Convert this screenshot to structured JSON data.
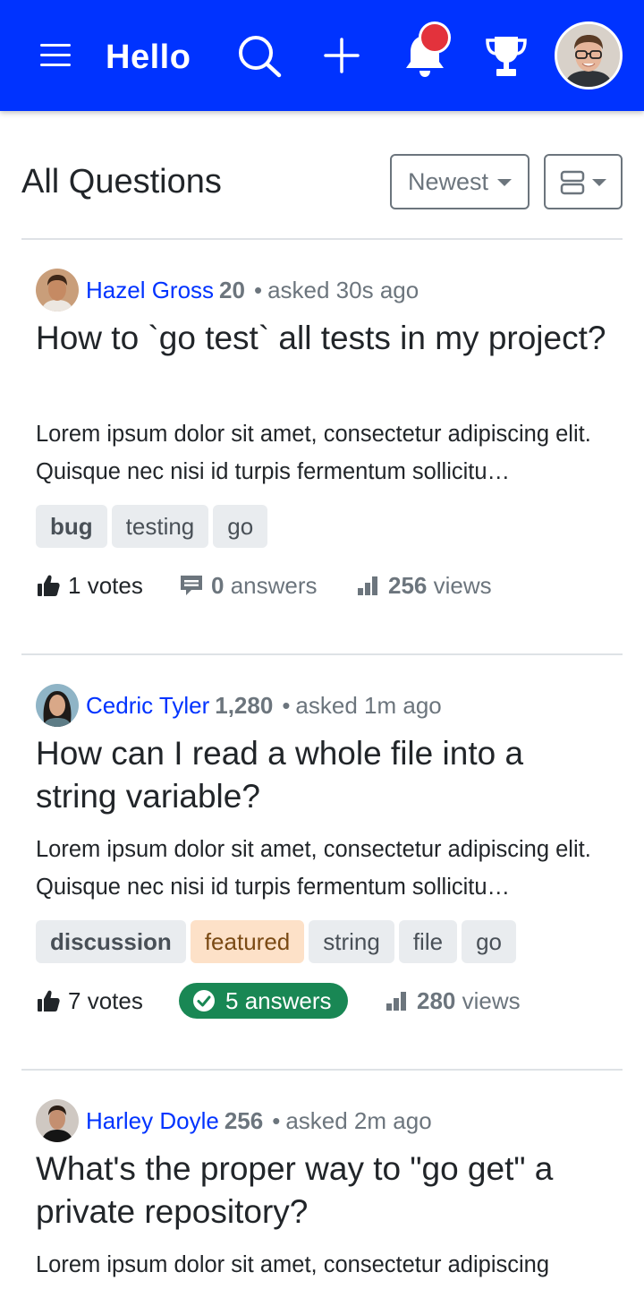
{
  "nav": {
    "brand": "Hello",
    "menu_icon": "hamburger-menu-icon",
    "search_icon": "search-icon",
    "add_icon": "plus-icon",
    "notification_icon": "bell-icon",
    "achievements_icon": "trophy-icon",
    "accent_color": "#0033ff",
    "notification_dot_color": "#e3323c"
  },
  "header": {
    "title": "All Questions",
    "sort_label": "Newest",
    "view_toggle_icon": "list-view-icon"
  },
  "questions": [
    {
      "user": "Hazel Gross",
      "reputation": "20",
      "asked": "asked 30s ago",
      "title": "How to `go test` all tests in my project?",
      "excerpt": "Lorem ipsum dolor sit amet, consectetur adipiscing elit. Quisque nec nisi id turpis fermentum sollicitu…",
      "tags": [
        "bug",
        "testing",
        "go"
      ],
      "votes": "1",
      "votes_label": "votes",
      "answers": "0",
      "answers_label": "answers",
      "views": "256",
      "views_label": "views"
    },
    {
      "user": "Cedric Tyler",
      "reputation": "1,280",
      "asked": "asked 1m ago",
      "title": "How can I read a whole file into a string variable?",
      "excerpt": "Lorem ipsum dolor sit amet, consectetur adipiscing elit. Quisque nec nisi id turpis fermentum sollicitu…",
      "tags": [
        "discussion",
        "featured",
        "string",
        "file",
        "go"
      ],
      "votes": "7",
      "votes_label": "votes",
      "answers": "5",
      "answers_label": "answers",
      "views": "280",
      "views_label": "views"
    },
    {
      "user": "Harley Doyle",
      "reputation": "256",
      "asked": "asked 2m ago",
      "title": "What's the proper way to \"go get\" a private repository?",
      "excerpt": "Lorem ipsum dolor sit amet, consectetur adipiscing"
    }
  ],
  "separator": "•",
  "colors": {
    "answered_badge": "#198754",
    "featured_tag": "#fde1c8",
    "tag": "#e9ecef"
  }
}
